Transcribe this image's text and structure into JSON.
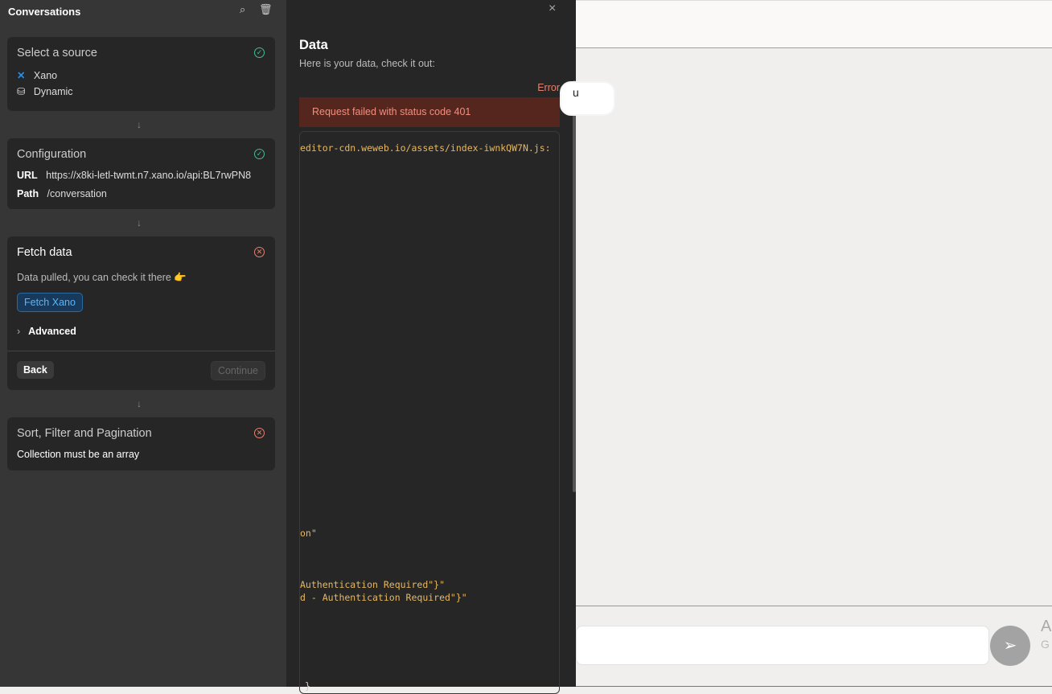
{
  "sidebar": {
    "title": "Conversations",
    "source": {
      "title": "Select a source",
      "items": [
        "Xano",
        "Dynamic"
      ]
    },
    "config": {
      "title": "Configuration",
      "url_label": "URL",
      "url": "https://x8ki-letl-twmt.n7.xano.io/api:BL7rwPN8",
      "path_label": "Path",
      "path": "/conversation"
    },
    "fetch": {
      "title": "Fetch data",
      "text": "Data pulled, you can check it there",
      "emoji": "👉",
      "fetch_button": "Fetch Xano",
      "advanced": "Advanced",
      "back": "Back",
      "continue": "Continue"
    },
    "sort": {
      "title": "Sort, Filter and Pagination",
      "text": "Collection must be an array"
    }
  },
  "data_panel": {
    "title": "Data",
    "subtitle": "Here is your data, check it out:",
    "status": "Error",
    "error_message": "Request failed with status code 401",
    "code_lines": [
      "editor-cdn.weweb.io/assets/index-iwnkQW7N.js:",
      "on\"",
      "Authentication Required\"}\"",
      "d - Authentication Required\"}\"",
      "}"
    ]
  },
  "chat": {
    "bubble_text": "u",
    "side_text_1": "A",
    "side_text_2": "G"
  }
}
